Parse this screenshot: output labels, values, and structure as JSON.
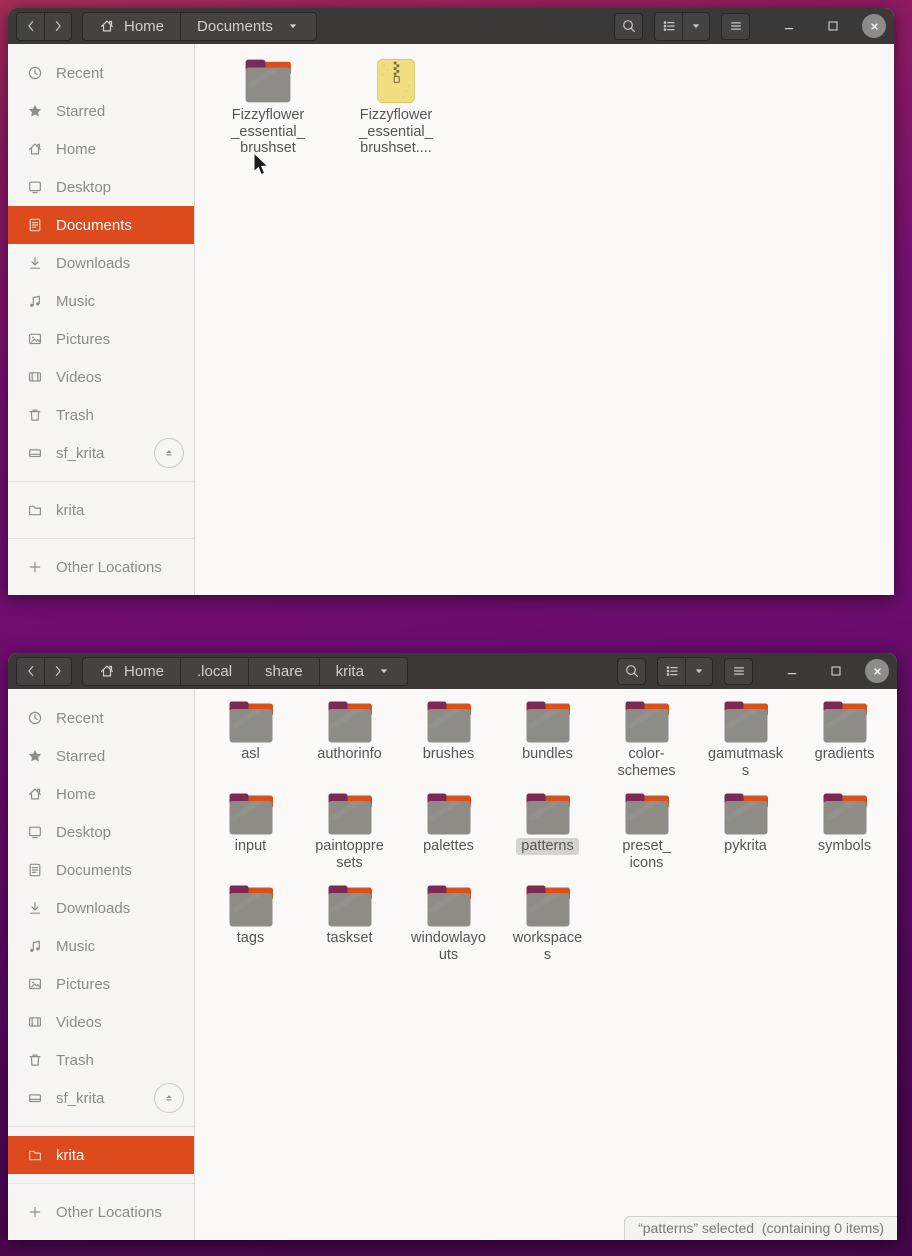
{
  "desktop": {
    "wallpaper_top_color": "#a52e56",
    "wallpaper_mid_color": "#6e0d6e",
    "wallpaper_bottom_color": "#440648"
  },
  "theme": {
    "accent_selected": "#dc4a1e",
    "titlebar_bg": "#3b3937",
    "sidebar_bg": "#f6f5f3",
    "content_bg": "#faf9f8",
    "folder_body": "#8e8c87",
    "folder_tab": "#7d2a52",
    "folder_strip": "#d8511c",
    "archive_body": "#f1de83"
  },
  "window_top": {
    "titlebar": {
      "nav_icons": [
        "chevron-left-icon",
        "chevron-right-icon"
      ],
      "path": [
        {
          "label": "Home",
          "icon": "home-icon"
        },
        {
          "label": "Documents",
          "dropdown": true
        }
      ],
      "action_icons": [
        "search-icon",
        "list-view-icon",
        "chevron-down-icon",
        "menu-icon"
      ],
      "window_control_icons": [
        "minimize-icon",
        "maximize-icon",
        "close-icon"
      ]
    },
    "sidebar": {
      "items": [
        {
          "label": "Recent",
          "icon": "clock-icon"
        },
        {
          "label": "Starred",
          "icon": "star-icon"
        },
        {
          "label": "Home",
          "icon": "home-icon"
        },
        {
          "label": "Desktop",
          "icon": "desktop-icon"
        },
        {
          "label": "Documents",
          "icon": "document-icon",
          "selected": true
        },
        {
          "label": "Downloads",
          "icon": "download-icon"
        },
        {
          "label": "Music",
          "icon": "music-icon"
        },
        {
          "label": "Pictures",
          "icon": "picture-icon"
        },
        {
          "label": "Videos",
          "icon": "video-icon"
        },
        {
          "label": "Trash",
          "icon": "trash-icon"
        },
        {
          "label": "sf_krita",
          "icon": "drive-icon",
          "eject": true
        },
        {
          "separator": true
        },
        {
          "label": "krita",
          "icon": "folder-outline-icon"
        },
        {
          "separator": true
        },
        {
          "label": "Other Locations",
          "icon": "plus-icon"
        }
      ]
    },
    "files": [
      {
        "label": "Fizzyflower_essential_brushset",
        "icon": "folder-icon",
        "display_lines": [
          "Fizzyflower",
          "_essential_",
          "brushset"
        ]
      },
      {
        "label": "Fizzyflower_essential_brushset....",
        "icon": "archive-icon",
        "display_lines": [
          "Fizzyflower",
          "_essential_",
          "brushset...."
        ]
      }
    ]
  },
  "window_bottom": {
    "titlebar": {
      "nav_icons": [
        "chevron-left-icon",
        "chevron-right-icon"
      ],
      "path": [
        {
          "label": "Home",
          "icon": "home-icon"
        },
        {
          "label": ".local"
        },
        {
          "label": "share"
        },
        {
          "label": "krita",
          "dropdown": true
        }
      ],
      "action_icons": [
        "search-icon",
        "list-view-icon",
        "chevron-down-icon",
        "menu-icon"
      ],
      "window_control_icons": [
        "minimize-icon",
        "maximize-icon",
        "close-icon"
      ]
    },
    "sidebar": {
      "items": [
        {
          "label": "Recent",
          "icon": "clock-icon"
        },
        {
          "label": "Starred",
          "icon": "star-icon"
        },
        {
          "label": "Home",
          "icon": "home-icon"
        },
        {
          "label": "Desktop",
          "icon": "desktop-icon"
        },
        {
          "label": "Documents",
          "icon": "document-icon"
        },
        {
          "label": "Downloads",
          "icon": "download-icon"
        },
        {
          "label": "Music",
          "icon": "music-icon"
        },
        {
          "label": "Pictures",
          "icon": "picture-icon"
        },
        {
          "label": "Videos",
          "icon": "video-icon"
        },
        {
          "label": "Trash",
          "icon": "trash-icon"
        },
        {
          "label": "sf_krita",
          "icon": "drive-icon",
          "eject": true
        },
        {
          "separator": true
        },
        {
          "label": "krita",
          "icon": "folder-outline-icon",
          "selected": true
        },
        {
          "separator": true
        },
        {
          "label": "Other Locations",
          "icon": "plus-icon"
        }
      ]
    },
    "files": [
      {
        "label": "asl",
        "icon": "folder-icon",
        "display_lines": [
          "asl"
        ]
      },
      {
        "label": "authorinfo",
        "icon": "folder-icon",
        "display_lines": [
          "authorinfo"
        ]
      },
      {
        "label": "brushes",
        "icon": "folder-icon",
        "display_lines": [
          "brushes"
        ]
      },
      {
        "label": "bundles",
        "icon": "folder-icon",
        "display_lines": [
          "bundles"
        ]
      },
      {
        "label": "color-schemes",
        "icon": "folder-icon",
        "display_lines": [
          "color-",
          "schemes"
        ]
      },
      {
        "label": "gamutmasks",
        "icon": "folder-icon",
        "display_lines": [
          "gamutmask",
          "s"
        ]
      },
      {
        "label": "gradients",
        "icon": "folder-icon",
        "display_lines": [
          "gradients"
        ]
      },
      {
        "label": "input",
        "icon": "folder-icon",
        "display_lines": [
          "input"
        ]
      },
      {
        "label": "paintoppresets",
        "icon": "folder-icon",
        "display_lines": [
          "paintoppre",
          "sets"
        ]
      },
      {
        "label": "palettes",
        "icon": "folder-icon",
        "display_lines": [
          "palettes"
        ]
      },
      {
        "label": "patterns",
        "icon": "folder-icon",
        "display_lines": [
          "patterns"
        ],
        "selected": true
      },
      {
        "label": "preset_icons",
        "icon": "folder-icon",
        "display_lines": [
          "preset_",
          "icons"
        ]
      },
      {
        "label": "pykrita",
        "icon": "folder-icon",
        "display_lines": [
          "pykrita"
        ]
      },
      {
        "label": "symbols",
        "icon": "folder-icon",
        "display_lines": [
          "symbols"
        ]
      },
      {
        "label": "tags",
        "icon": "folder-icon",
        "display_lines": [
          "tags"
        ]
      },
      {
        "label": "taskset",
        "icon": "folder-icon",
        "display_lines": [
          "taskset"
        ]
      },
      {
        "label": "windowlayouts",
        "icon": "folder-icon",
        "display_lines": [
          "windowlayo",
          "uts"
        ]
      },
      {
        "label": "workspaces",
        "icon": "folder-icon",
        "display_lines": [
          "workspace",
          "s"
        ]
      }
    ],
    "status_text": "“patterns” selected  (containing 0 items)"
  }
}
